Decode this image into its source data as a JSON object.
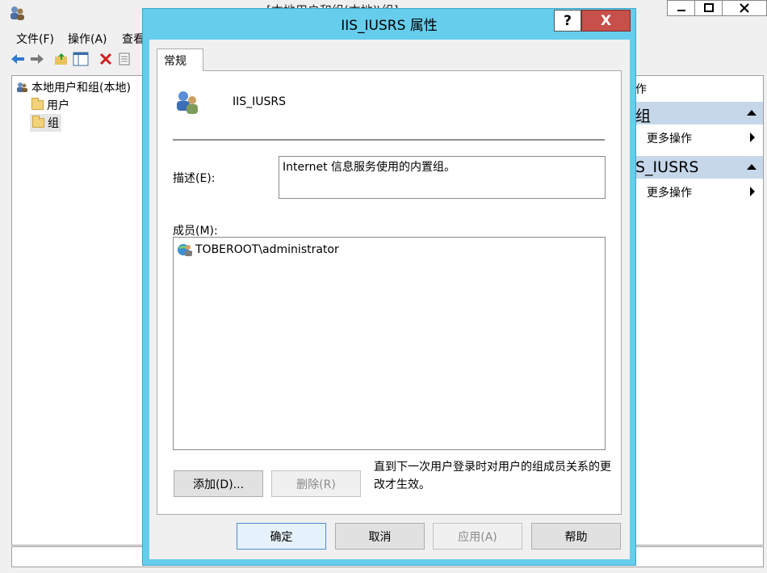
{
  "bg_window": {
    "title": "[本地用户和组(本地)\\组]",
    "menu": [
      "文件(F)",
      "操作(A)",
      "查看"
    ],
    "tree": {
      "root": "本地用户和组(本地)",
      "items": [
        "用户",
        "组"
      ]
    },
    "actions": {
      "header_partial": "作",
      "section1_header": "组",
      "section1_item": "更多操作",
      "section2_header": "S_IUSRS",
      "section2_item": "更多操作"
    }
  },
  "dialog": {
    "title": "IIS_IUSRS 属性",
    "help_glyph": "?",
    "close_glyph": "X",
    "tab": "常规",
    "group_name": "IIS_IUSRS",
    "description_label": "描述(E):",
    "description_value": "Internet 信息服务使用的内置组。",
    "members_label": "成员(M):",
    "members": [
      "TOBEROOT\\administrator"
    ],
    "add_button": "添加(D)...",
    "remove_button": "删除(R)",
    "note": "直到下一次用户登录时对用户的组成员关系的更改才生效。",
    "ok_button": "确定",
    "cancel_button": "取消",
    "apply_button": "应用(A)",
    "help_button": "帮助"
  }
}
